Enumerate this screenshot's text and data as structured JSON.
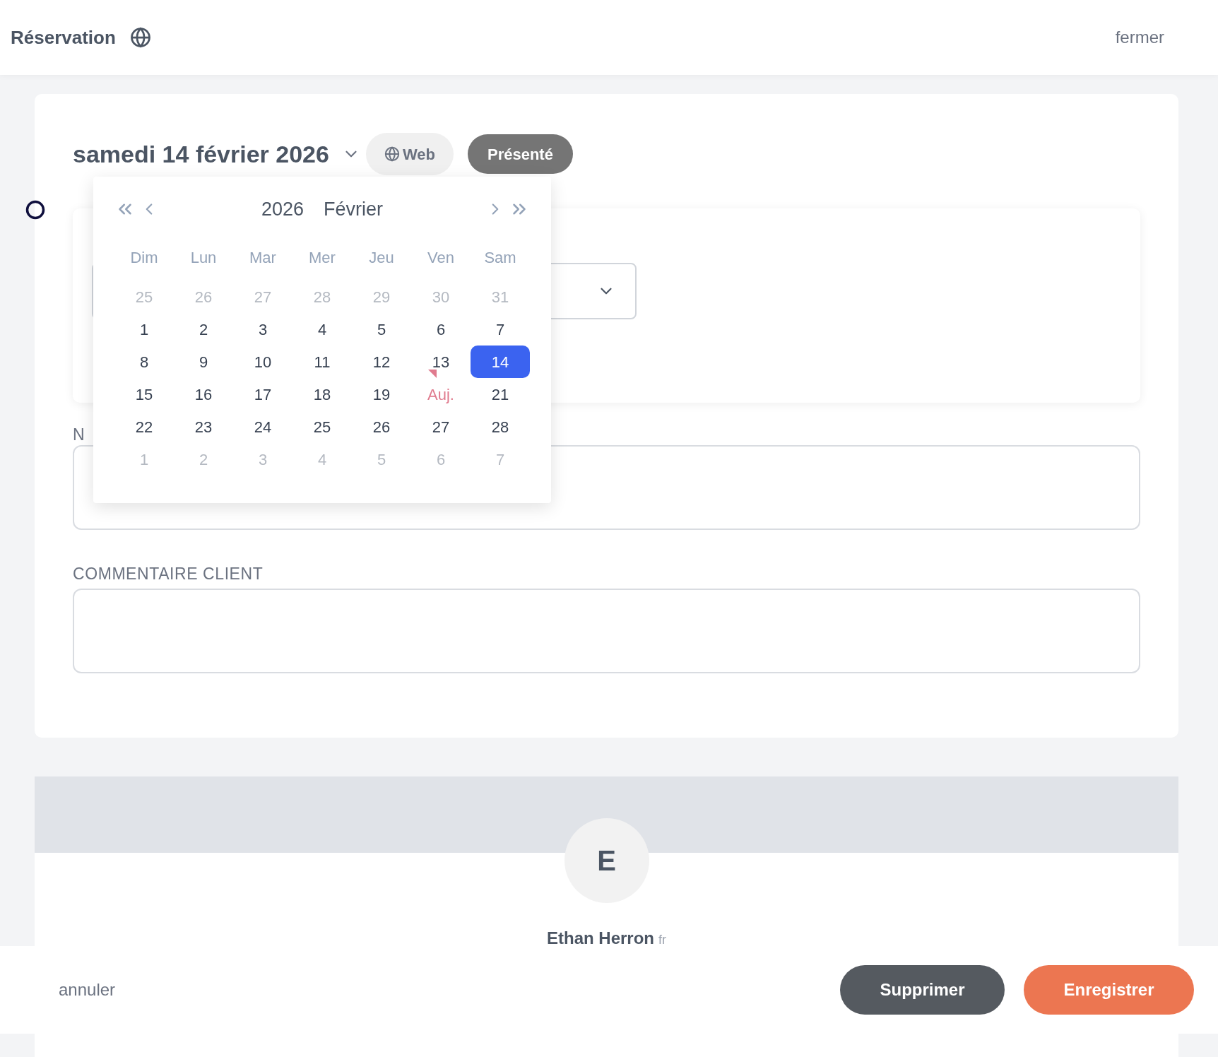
{
  "header": {
    "title": "Réservation",
    "close": "fermer"
  },
  "reservation": {
    "date": "samedi 14 février 2026",
    "source": "Web",
    "status": "Présenté"
  },
  "calendar": {
    "year": "2026",
    "month": "Février",
    "weekdays": [
      "Dim",
      "Lun",
      "Mar",
      "Mer",
      "Jeu",
      "Ven",
      "Sam"
    ],
    "weeks": [
      [
        {
          "day": "25",
          "kind": "other",
          "selected": false
        },
        {
          "day": "26",
          "kind": "other",
          "selected": false
        },
        {
          "day": "27",
          "kind": "other",
          "selected": false
        },
        {
          "day": "28",
          "kind": "other",
          "selected": false
        },
        {
          "day": "29",
          "kind": "other",
          "selected": false
        },
        {
          "day": "30",
          "kind": "other",
          "selected": false
        },
        {
          "day": "31",
          "kind": "other",
          "selected": false
        }
      ],
      [
        {
          "day": "1",
          "kind": "month",
          "selected": false
        },
        {
          "day": "2",
          "kind": "month",
          "selected": false
        },
        {
          "day": "3",
          "kind": "month",
          "selected": false
        },
        {
          "day": "4",
          "kind": "month",
          "selected": false
        },
        {
          "day": "5",
          "kind": "month",
          "selected": false
        },
        {
          "day": "6",
          "kind": "month",
          "selected": false
        },
        {
          "day": "7",
          "kind": "month",
          "selected": false
        }
      ],
      [
        {
          "day": "8",
          "kind": "month",
          "selected": false
        },
        {
          "day": "9",
          "kind": "month",
          "selected": false
        },
        {
          "day": "10",
          "kind": "month",
          "selected": false
        },
        {
          "day": "11",
          "kind": "month",
          "selected": false
        },
        {
          "day": "12",
          "kind": "month",
          "selected": false
        },
        {
          "day": "13",
          "kind": "month",
          "selected": false
        },
        {
          "day": "14",
          "kind": "month",
          "selected": true
        }
      ],
      [
        {
          "day": "15",
          "kind": "month",
          "selected": false
        },
        {
          "day": "16",
          "kind": "month",
          "selected": false
        },
        {
          "day": "17",
          "kind": "month",
          "selected": false
        },
        {
          "day": "18",
          "kind": "month",
          "selected": false
        },
        {
          "day": "19",
          "kind": "month",
          "selected": false
        },
        {
          "day": "Auj.",
          "kind": "today",
          "selected": false
        },
        {
          "day": "21",
          "kind": "month",
          "selected": false
        }
      ],
      [
        {
          "day": "22",
          "kind": "month",
          "selected": false
        },
        {
          "day": "23",
          "kind": "month",
          "selected": false
        },
        {
          "day": "24",
          "kind": "month",
          "selected": false
        },
        {
          "day": "25",
          "kind": "month",
          "selected": false
        },
        {
          "day": "26",
          "kind": "month",
          "selected": false
        },
        {
          "day": "27",
          "kind": "month",
          "selected": false
        },
        {
          "day": "28",
          "kind": "month",
          "selected": false
        }
      ],
      [
        {
          "day": "1",
          "kind": "other",
          "selected": false
        },
        {
          "day": "2",
          "kind": "other",
          "selected": false
        },
        {
          "day": "3",
          "kind": "other",
          "selected": false
        },
        {
          "day": "4",
          "kind": "other",
          "selected": false
        },
        {
          "day": "5",
          "kind": "other",
          "selected": false
        },
        {
          "day": "6",
          "kind": "other",
          "selected": false
        },
        {
          "day": "7",
          "kind": "other",
          "selected": false
        }
      ]
    ]
  },
  "notes_label": "N",
  "comment_label": "COMMENTAIRE CLIENT",
  "customer": {
    "initial": "E",
    "name": "Ethan Herron",
    "lang": "fr"
  },
  "footer": {
    "cancel": "annuler",
    "delete": "Supprimer",
    "save": "Enregistrer"
  }
}
